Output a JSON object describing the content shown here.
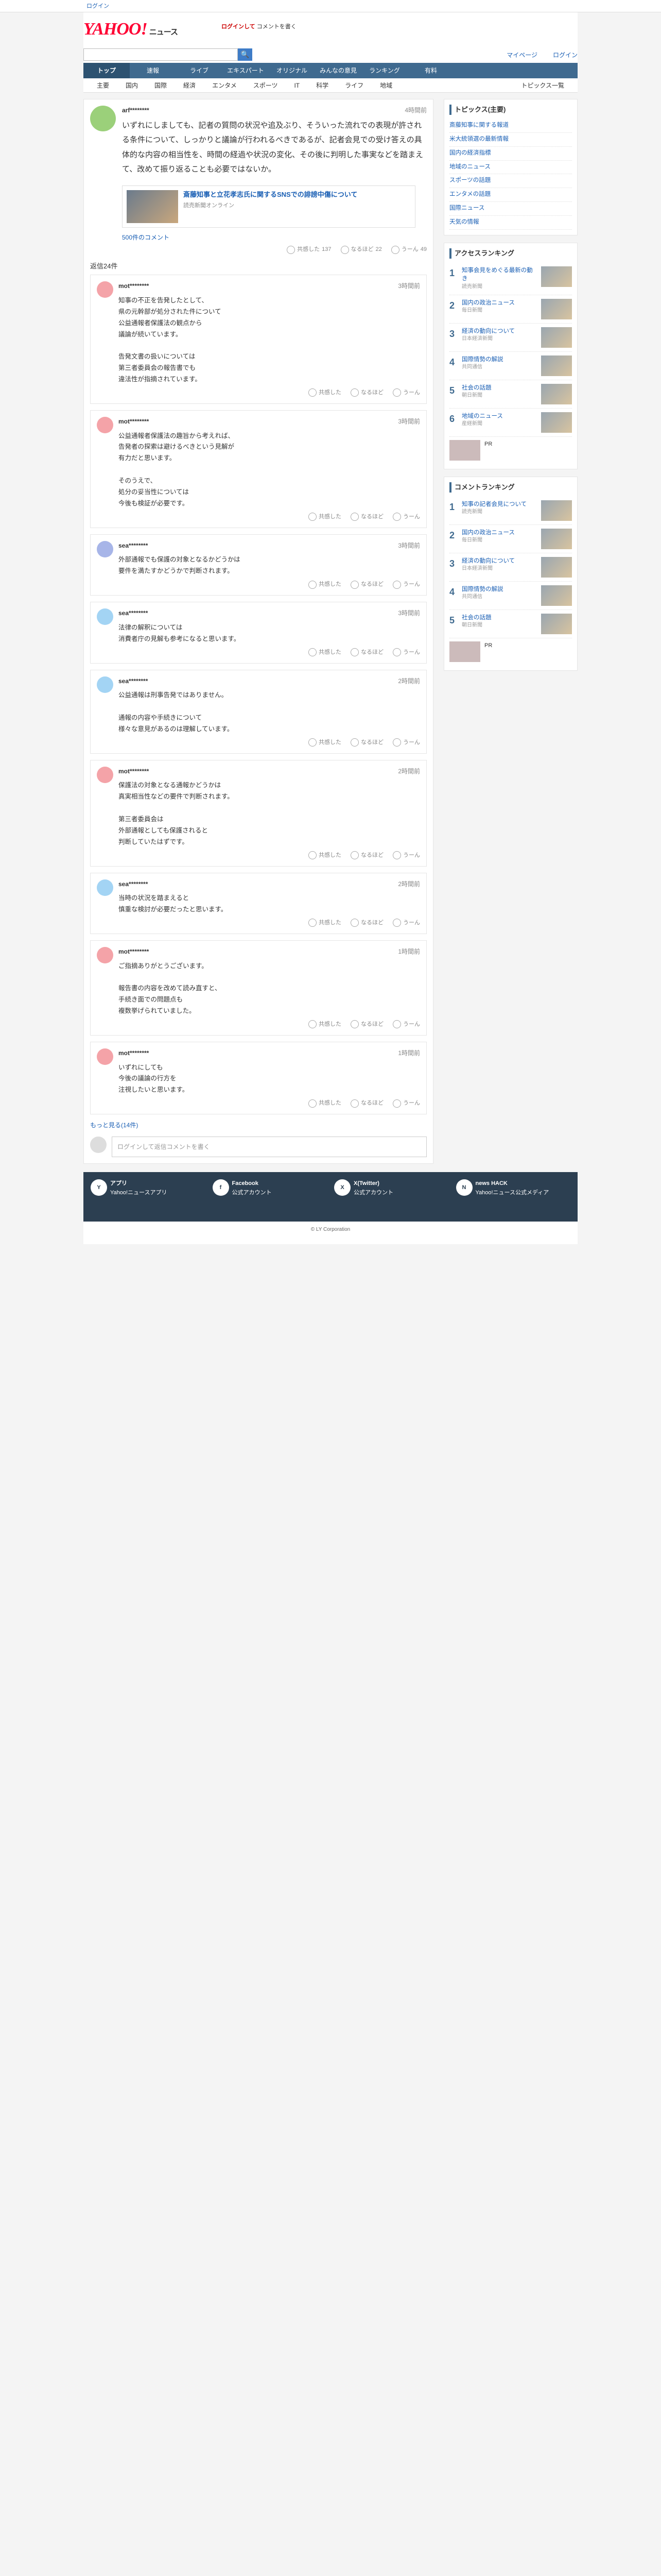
{
  "topbar": "ログイン",
  "header": {
    "logo": "YAHOO!",
    "logo_sub": "ニュース",
    "promo1": "ログインして",
    "promo2": "コメントを書く",
    "search_placeholder": "",
    "search_btn": "検索",
    "myname": "マイページ",
    "signin": "ログイン"
  },
  "nav": [
    "トップ",
    "速報",
    "ライブ",
    "エキスパート",
    "オリジナル",
    "みんなの意見",
    "ランキング",
    "有料"
  ],
  "subnav": [
    "主要",
    "国内",
    "国際",
    "経済",
    "エンタメ",
    "スポーツ",
    "IT",
    "科学",
    "ライフ",
    "地域"
  ],
  "subnav_more": "トピックス一覧",
  "post": {
    "user": "arf********",
    "time": "4時間前",
    "body": "いずれにしましても、記者の質問の状況や追及ぶり、そういった流れでの表現が許される条件について、しっかりと議論が行われるべきであるが、記者会見での受け答えの具体的な内容の相当性を、時間の経過や状況の変化、その後に判明した事実などを踏まえて、改めて振り返ることも必要ではないか。",
    "reacts": [
      "共感した",
      "なるほど",
      "うーん"
    ],
    "counts": [
      "137",
      "22",
      "49"
    ]
  },
  "article": {
    "title": "斎藤知事と立花孝志氏に関するSNSでの誹謗中傷について",
    "meta": "読売新聞オンライン"
  },
  "comments_link": "500件のコメント",
  "ct": "返信24件",
  "comments": [
    {
      "user": "mot********",
      "time": "3時間前",
      "text": "知事の不正を告発したとして、\n県の元幹部が処分された件について\n公益通報者保護法の観点から\n議論が続いています。\n\n告発文書の扱いについては\n第三者委員会の報告書でも\n違法性が指摘されています。",
      "c": [
        "共感した",
        "なるほど",
        "うーん"
      ]
    },
    {
      "user": "mot********",
      "time": "3時間前",
      "text": "公益通報者保護法の趣旨から考えれば、\n告発者の探索は避けるべきという見解が\n有力だと思います。\n\nそのうえで、\n処分の妥当性については\n今後も検証が必要です。",
      "c": [
        "共感した",
        "なるほど",
        "うーん"
      ]
    },
    {
      "user": "sea********",
      "time": "3時間前",
      "text": "外部通報でも保護の対象となるかどうかは\n要件を満たすかどうかで判断されます。",
      "c": [
        "共感した",
        "なるほど",
        "うーん"
      ]
    },
    {
      "user": "sea********",
      "time": "3時間前",
      "text": "法律の解釈については\n消費者庁の見解も参考になると思います。",
      "c": [
        "共感した",
        "なるほど",
        "うーん"
      ]
    },
    {
      "user": "sea********",
      "time": "2時間前",
      "text": "公益通報は刑事告発ではありません。\n\n通報の内容や手続きについて\n様々な意見があるのは理解しています。",
      "c": [
        "共感した",
        "なるほど",
        "うーん"
      ]
    },
    {
      "user": "mot********",
      "time": "2時間前",
      "text": "保護法の対象となる通報かどうかは\n真実相当性などの要件で判断されます。\n\n第三者委員会は\n外部通報としても保護されると\n判断していたはずです。",
      "c": [
        "共感した",
        "なるほど",
        "うーん"
      ]
    },
    {
      "user": "sea********",
      "time": "2時間前",
      "text": "当時の状況を踏まえると\n慎重な検討が必要だったと思います。",
      "c": [
        "共感した",
        "なるほど",
        "うーん"
      ]
    },
    {
      "user": "mot********",
      "time": "1時間前",
      "text": "ご指摘ありがとうございます。\n\n報告書の内容を改めて読み直すと、\n手続き面での問題点も\n複数挙げられていました。",
      "c": [
        "共感した",
        "なるほど",
        "うーん"
      ]
    },
    {
      "user": "mot********",
      "time": "1時間前",
      "text": "いずれにしても\n今後の議論の行方を\n注視したいと思います。",
      "c": [
        "共感した",
        "なるほど",
        "うーん"
      ]
    }
  ],
  "more": "もっと見る(14件)",
  "form_placeholder": "ログインして返信コメントを書く",
  "side": {
    "topics_title": "トピックス(主要)",
    "topics": [
      "斎藤知事に関する報道",
      "米大統領選の最新情報",
      "国内の経済指標",
      "地域のニュース",
      "スポーツの話題",
      "エンタメの話題",
      "国際ニュース",
      "天気の情報"
    ],
    "access_title": "アクセスランキング",
    "access": [
      {
        "t": "知事会見をめぐる最新の動き",
        "s": "読売新聞"
      },
      {
        "t": "国内の政治ニュース",
        "s": "毎日新聞"
      },
      {
        "t": "経済の動向について",
        "s": "日本経済新聞"
      },
      {
        "t": "国際情勢の解説",
        "s": "共同通信"
      },
      {
        "t": "社会の話題",
        "s": "朝日新聞"
      },
      {
        "t": "地域のニュース",
        "s": "産経新聞"
      }
    ],
    "comment_title": "コメントランキング",
    "comment": [
      {
        "t": "知事の記者会見について",
        "s": "読売新聞"
      },
      {
        "t": "国内の政治ニュース",
        "s": "毎日新聞"
      },
      {
        "t": "経済の動向について",
        "s": "日本経済新聞"
      },
      {
        "t": "国際情勢の解説",
        "s": "共同通信"
      },
      {
        "t": "社会の話題",
        "s": "朝日新聞"
      }
    ],
    "pr1": "PR",
    "pr2": "PR"
  },
  "footer": [
    {
      "name": "アプリ",
      "d": "Yahoo!ニュースアプリ"
    },
    {
      "name": "Facebook",
      "d": "公式アカウント"
    },
    {
      "name": "X(Twitter)",
      "d": "公式アカウント"
    },
    {
      "name": "news HACK",
      "d": "Yahoo!ニュース公式メディア"
    }
  ],
  "copyright": "© LY Corporation"
}
